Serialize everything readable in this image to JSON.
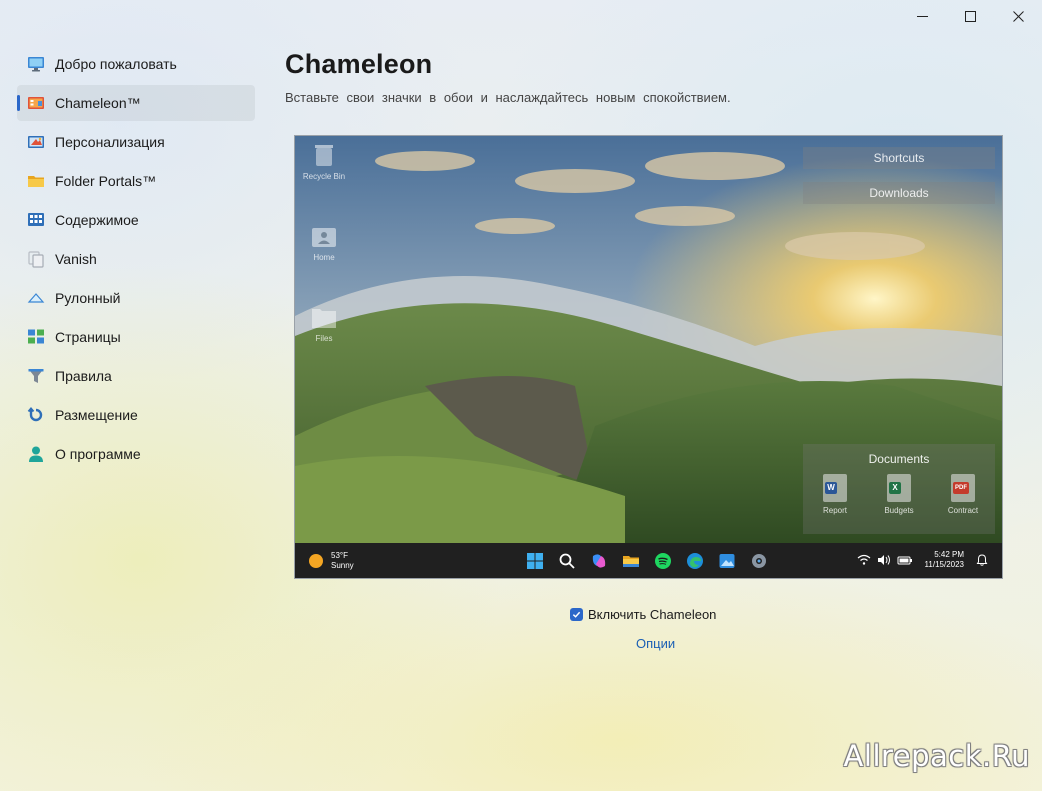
{
  "window": {
    "controls": [
      {
        "name": "minimize-button",
        "icon": "minimize-icon"
      },
      {
        "name": "maximize-button",
        "icon": "maximize-icon"
      },
      {
        "name": "close-button",
        "icon": "close-icon"
      }
    ]
  },
  "sidebar": {
    "items": [
      {
        "label": "Добро пожаловать",
        "icon": "monitor-icon"
      },
      {
        "label": "Chameleon™",
        "icon": "chameleon-icon",
        "active": true
      },
      {
        "label": "Персонализация",
        "icon": "personalization-icon"
      },
      {
        "label": "Folder Portals™",
        "icon": "folder-icon"
      },
      {
        "label": "Содержимое",
        "icon": "content-grid-icon"
      },
      {
        "label": "Vanish",
        "icon": "vanish-icon"
      },
      {
        "label": "Рулонный",
        "icon": "roll-up-icon"
      },
      {
        "label": "Страницы",
        "icon": "pages-icon"
      },
      {
        "label": "Правила",
        "icon": "filter-icon"
      },
      {
        "label": "Размещение",
        "icon": "placement-icon"
      },
      {
        "label": "О программе",
        "icon": "person-icon"
      }
    ]
  },
  "main": {
    "title": "Chameleon",
    "subtitle": "Вставьте свои значки в обои и наслаждайтесь новым спокойствием."
  },
  "preview": {
    "desktop_icons": [
      {
        "label": "Recycle Bin",
        "icon": "recycle-bin-icon"
      },
      {
        "label": "Home",
        "icon": "home-folder-icon"
      },
      {
        "label": "Files",
        "icon": "files-folder-icon"
      }
    ],
    "fences": [
      "Shortcuts",
      "Downloads"
    ],
    "documents": {
      "title": "Documents",
      "items": [
        {
          "label": "Report",
          "badge": "W",
          "color": "#2b5797"
        },
        {
          "label": "Budgets",
          "badge": "X",
          "color": "#217346"
        },
        {
          "label": "Contract",
          "badge": "PDF",
          "color": "#c43b2c"
        }
      ]
    },
    "taskbar": {
      "weather_temp": "53°F",
      "weather_desc": "Sunny",
      "apps": [
        "windows-start-icon",
        "search-icon",
        "copilot-icon",
        "file-explorer-icon",
        "spotify-icon",
        "edge-icon",
        "photos-icon",
        "settings-icon"
      ],
      "time": "5:42 PM",
      "date": "11/15/2023"
    }
  },
  "enable_label": "Включить Chameleon",
  "enable_checked": true,
  "options_label": "Опции",
  "watermark": "Allrepack.Ru",
  "colors": {
    "accent": "#2b67c9",
    "link": "#1a5fb4"
  }
}
